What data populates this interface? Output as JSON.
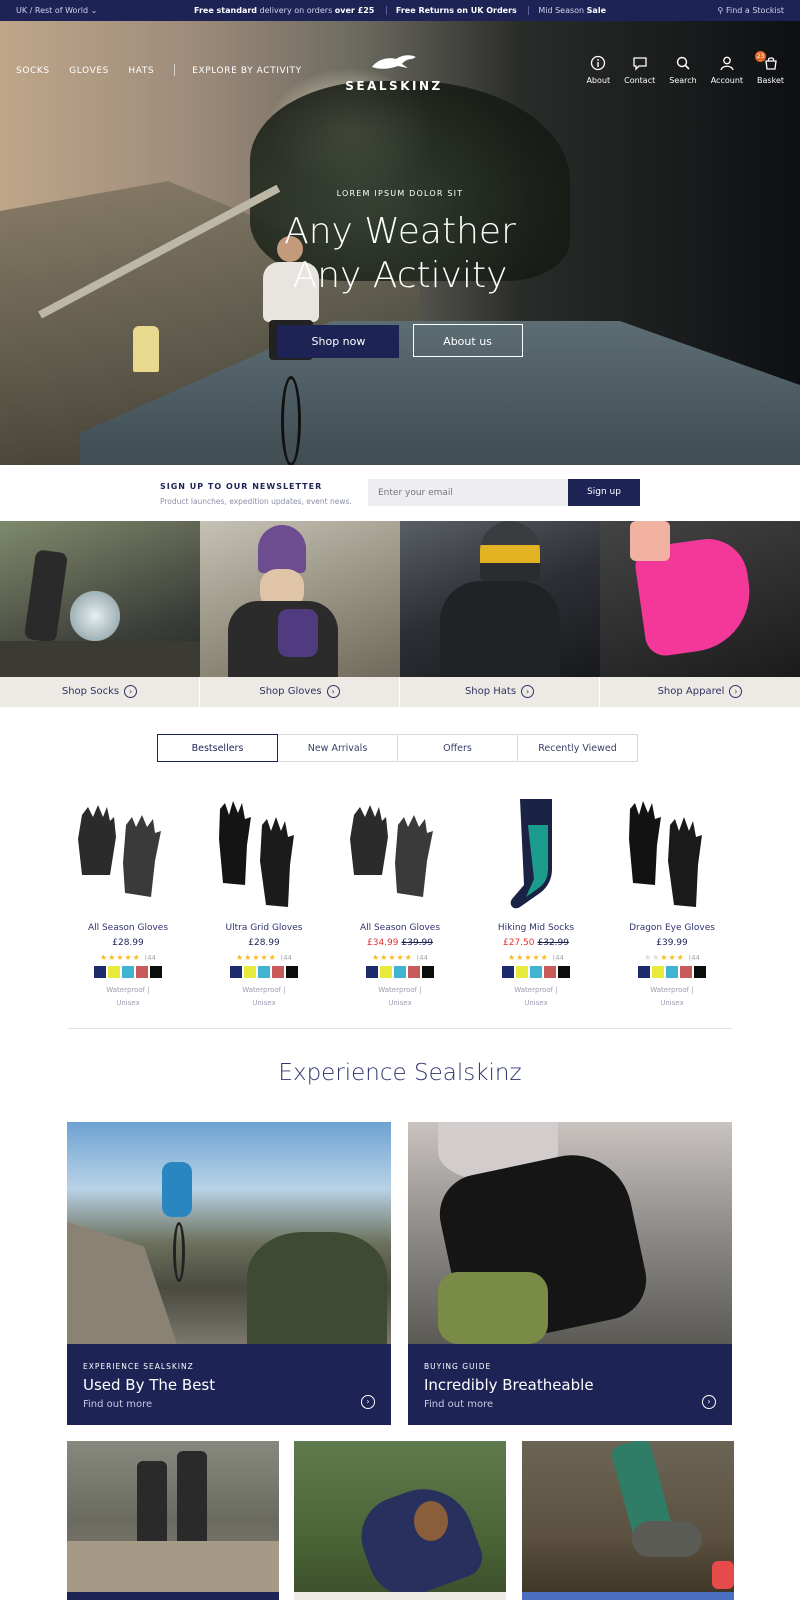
{
  "topbar": {
    "region": "UK / Rest of World",
    "promo_1_bold": "Free standard",
    "promo_1_rest": " delivery on orders ",
    "promo_1_bold2": "over £25",
    "promo_2": "Free Returns on UK Orders",
    "promo_3_a": "Mid Season ",
    "promo_3_b": "Sale",
    "stockist": "Find a Stockist"
  },
  "nav": {
    "left": [
      "SOCKS",
      "GLOVES",
      "HATS",
      "EXPLORE BY ACTIVITY"
    ],
    "logo": "SEALSKINZ",
    "right": [
      {
        "label": "About",
        "icon": "info-icon"
      },
      {
        "label": "Contact",
        "icon": "chat-icon"
      },
      {
        "label": "Search",
        "icon": "search-icon"
      },
      {
        "label": "Account",
        "icon": "user-icon"
      },
      {
        "label": "Basket",
        "icon": "basket-icon"
      }
    ],
    "basket_count": "23"
  },
  "hero": {
    "kicker": "LOREM IPSUM DOLOR SIT",
    "line1": "Any Weather",
    "line2": "Any Activity",
    "primary_btn": "Shop now",
    "secondary_btn": "About us"
  },
  "newsletter": {
    "title": "SIGN UP TO OUR NEWSLETTER",
    "subtitle": "Product launches, expedition updates, event news.",
    "placeholder": "Enter your email",
    "button": "Sign up"
  },
  "categories": [
    {
      "label": "Shop Socks"
    },
    {
      "label": "Shop Gloves"
    },
    {
      "label": "Shop Hats"
    },
    {
      "label": "Shop Apparel"
    }
  ],
  "tabs": [
    "Bestsellers",
    "New Arrivals",
    "Offers",
    "Recently Viewed"
  ],
  "products": [
    {
      "name": "All Season Gloves",
      "price": "£28.99",
      "sale": "",
      "was": "",
      "rating": 5,
      "reviews": "(44",
      "tag1": "Waterproof |",
      "tag2": "Unisex"
    },
    {
      "name": "Ultra Grid Gloves",
      "price": "£28.99",
      "sale": "",
      "was": "",
      "rating": 5,
      "reviews": "(44",
      "tag1": "Waterproof |",
      "tag2": "Unisex"
    },
    {
      "name": "All Season Gloves",
      "price": "",
      "sale": "£34.99",
      "was": "£39.99",
      "rating": 5,
      "reviews": "(44",
      "tag1": "Waterproof |",
      "tag2": "Unisex"
    },
    {
      "name": "Hiking Mid Socks",
      "price": "",
      "sale": "£27.50",
      "was": "£32.99",
      "rating": 5,
      "reviews": "(44",
      "tag1": "Waterproof |",
      "tag2": "Unisex"
    },
    {
      "name": "Dragon Eye Gloves",
      "price": "£39.99",
      "sale": "",
      "was": "",
      "rating": 3,
      "reviews": "(44",
      "tag1": "Waterproof |",
      "tag2": "Unisex"
    }
  ],
  "swatch_colors": [
    "#1e2a6e",
    "#e7ea3a",
    "#3fb3cf",
    "#c85a5a",
    "#0c0c0c"
  ],
  "experience": {
    "title": "Experience Sealskinz",
    "cards": [
      {
        "kicker": "EXPERIENCE SEALSKINZ",
        "heading": "Used By The Best",
        "link": "Find out more"
      },
      {
        "kicker": "BUYING GUIDE",
        "heading": "Incredibly Breatheable",
        "link": "Find out more"
      }
    ]
  },
  "colors": {
    "brand_navy": "#1e2356",
    "badge_orange": "#e06a2b",
    "sale_red": "#dd3333"
  }
}
